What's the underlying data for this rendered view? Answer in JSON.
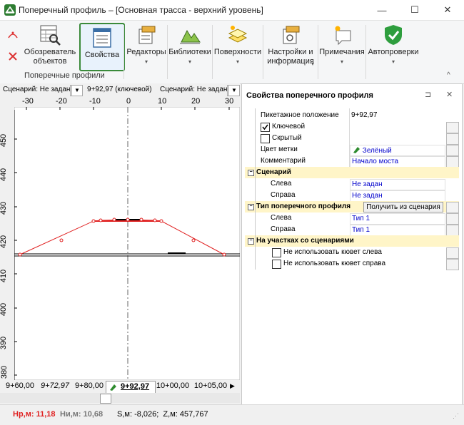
{
  "window": {
    "title": "Поперечный профиль – [Основная трасса - верхний уровень]",
    "min": "—",
    "max": "☐",
    "close": "✕"
  },
  "ribbon": {
    "buttons": [
      {
        "label": "Обозреватель\nобъектов"
      },
      {
        "label": "Свойства"
      },
      {
        "label": "Редакторы"
      },
      {
        "label": "Библиотеки"
      },
      {
        "label": "Поверхности"
      },
      {
        "label": "Настройки и\nинформация"
      },
      {
        "label": "Примечания"
      },
      {
        "label": "Автопроверки"
      }
    ],
    "group_label": "Поперечные профили",
    "collapse": "^"
  },
  "left_toolbar": {
    "scenario_left": "Сценарий: Не задан",
    "position": "9+92,97 (ключевой)",
    "scenario_right": "Сценарий: Не задан"
  },
  "axes": {
    "x_ticks": [
      "-30",
      "-20",
      "-10",
      "0",
      "10",
      "20",
      "30"
    ],
    "y_ticks": [
      "450",
      "440",
      "430",
      "420",
      "410",
      "400",
      "390",
      "380"
    ]
  },
  "ruler": {
    "tabs": [
      "9+60,00",
      "9+72,97",
      "9+80,00",
      "9+92,97",
      "10+00,00",
      "10+05,00"
    ],
    "active_index": 3
  },
  "properties": {
    "title": "Свойства поперечного профиля",
    "pin": "⊐",
    "close": "✕",
    "rows": {
      "picket_name": "Пикетажное положение",
      "picket_value": "9+92,97",
      "key_label": "Ключевой",
      "hidden_label": "Скрытый",
      "color_name": "Цвет метки",
      "color_value": "Зелёный",
      "comment_name": "Комментарий",
      "comment_value": "Начало моста",
      "scenario_section": "Сценарий",
      "left_name": "Слева",
      "left_value": "Не задан",
      "right_name": "Справа",
      "right_value": "Не задан",
      "type_section": "Тип поперечного профиля",
      "get_from_scenario": "Получить из сценария",
      "type_left_name": "Слева",
      "type_left_value": "Тип 1",
      "type_right_name": "Справа",
      "type_right_value": "Тип 1",
      "areas_section": "На участках со сценариями",
      "no_ditch_left": "Не использовать кювет слева",
      "no_ditch_right": "Не использовать кювет справа"
    },
    "key_checked": true,
    "hidden_checked": false
  },
  "status": {
    "hr": "Нр,м: 11,18",
    "hi": "Ни,м: 10,68",
    "coords": "S,м: -8,026;  Z,м: 457,767"
  }
}
